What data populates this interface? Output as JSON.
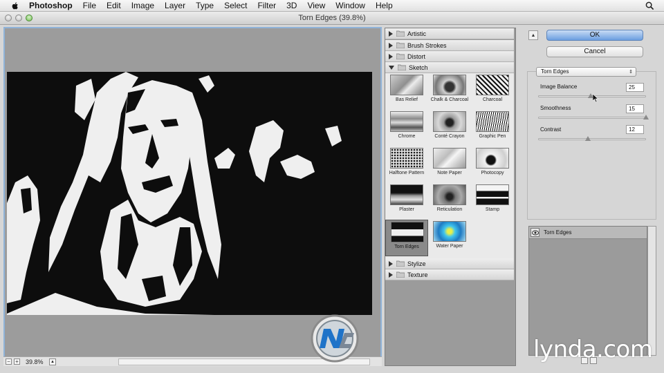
{
  "menubar": {
    "app": "Photoshop",
    "items": [
      "File",
      "Edit",
      "Image",
      "Layer",
      "Type",
      "Select",
      "Filter",
      "3D",
      "View",
      "Window",
      "Help"
    ]
  },
  "window": {
    "title": "Torn Edges (39.8%)"
  },
  "preview": {
    "zoom": "39.8%"
  },
  "gallery": {
    "categories_top": [
      "Artistic",
      "Brush Strokes",
      "Distort"
    ],
    "open_category": "Sketch",
    "categories_bottom": [
      "Stylize",
      "Texture"
    ],
    "sketch_filters": [
      {
        "label": "Bas Relief"
      },
      {
        "label": "Chalk & Charcoal"
      },
      {
        "label": "Charcoal"
      },
      {
        "label": "Chrome"
      },
      {
        "label": "Conté Crayon"
      },
      {
        "label": "Graphic Pen"
      },
      {
        "label": "Halftone Pattern"
      },
      {
        "label": "Note Paper"
      },
      {
        "label": "Photocopy"
      },
      {
        "label": "Plaster"
      },
      {
        "label": "Reticulation"
      },
      {
        "label": "Stamp"
      },
      {
        "label": "Torn Edges",
        "selected": true
      },
      {
        "label": "Water Paper"
      }
    ]
  },
  "settings": {
    "ok_label": "OK",
    "cancel_label": "Cancel",
    "filter_select": "Torn Edges",
    "params": [
      {
        "label": "Image Balance",
        "value": "25",
        "fraction": 0.49
      },
      {
        "label": "Smoothness",
        "value": "15",
        "fraction": 1.0
      },
      {
        "label": "Contrast",
        "value": "12",
        "fraction": 0.46
      }
    ]
  },
  "layers": {
    "effect_layer": "Torn Edges"
  },
  "watermark": {
    "brand": "lynda.com"
  },
  "colors": {
    "accent": "#6b9ee0",
    "selection": "#8fb3d9"
  }
}
